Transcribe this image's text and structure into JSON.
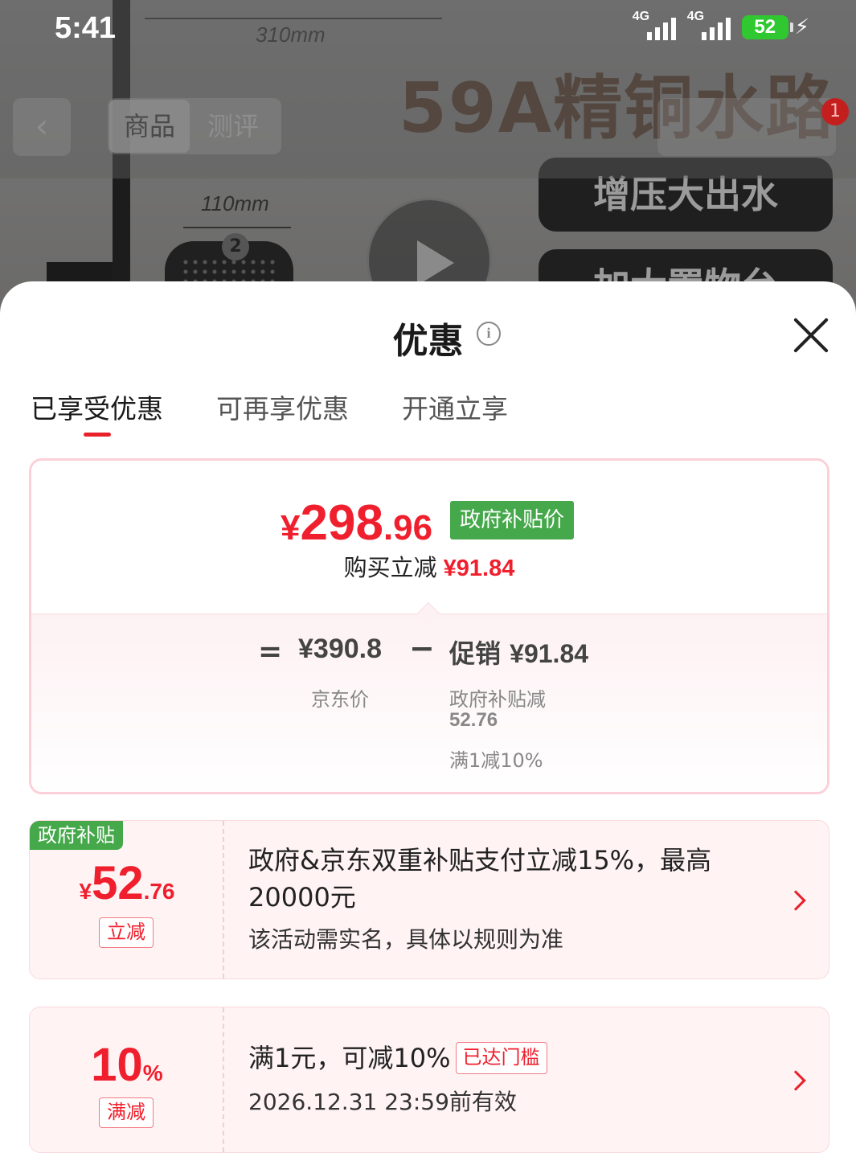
{
  "status_bar": {
    "time": "5:41",
    "network_1": "4G",
    "network_2": "4G",
    "battery": "52"
  },
  "background": {
    "dimension_top": "310mm",
    "dimension_head": "110mm",
    "headline": "59A精铜水路",
    "pill_1": "增压大出水",
    "pill_2": "加大置物台",
    "head_number": "2"
  },
  "product_nav": {
    "back": "‹",
    "tabs": [
      "商品",
      "测评"
    ],
    "cart_badge": "1"
  },
  "sheet": {
    "title": "优惠",
    "tabs": [
      {
        "label": "已享受优惠",
        "active": true
      },
      {
        "label": "可再享优惠",
        "active": false
      },
      {
        "label": "开通立享",
        "active": false
      }
    ]
  },
  "price_card": {
    "currency": "¥",
    "price_int": "298",
    "price_dec": ".96",
    "tag": "政府补贴价",
    "reduce_label": "购买立减",
    "reduce_amount": "¥91.84",
    "equals": "=",
    "base_price": "¥390.8",
    "base_label": "京东价",
    "minus": "−",
    "promo_label": "促销",
    "promo_amount": "¥91.84",
    "promo_detail_1": "政府补贴减",
    "promo_detail_2": "52.76",
    "promo_detail_3": "满1减10%"
  },
  "coupons": [
    {
      "corner": "政府补贴",
      "currency": "¥",
      "amount_int": "52",
      "amount_dec": ".76",
      "kind": "立减",
      "desc": "政府&京东双重补贴支付立减15%，最高20000元",
      "note": "该活动需实名，具体以规则为准"
    },
    {
      "amount_int": "10",
      "amount_suffix": "%",
      "kind": "满减",
      "desc": "满1元，可减10%",
      "badge": "已达门槛",
      "note": "2026.12.31 23:59前有效"
    }
  ],
  "colors": {
    "accent_red": "#f01f2d",
    "subsidy_green": "#45a84a",
    "card_border": "#fcd0d8"
  }
}
